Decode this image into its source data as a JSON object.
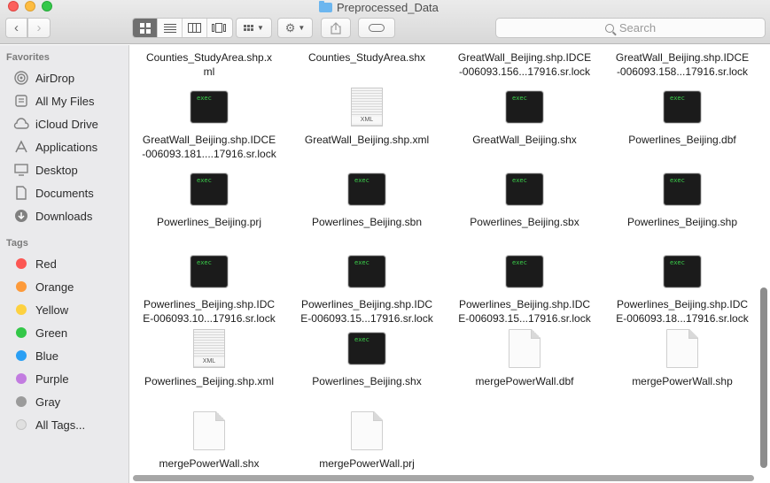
{
  "window": {
    "title": "Preprocessed_Data"
  },
  "toolbar": {
    "back_icon": "chevron-left",
    "forward_icon": "chevron-right",
    "search_placeholder": "Search"
  },
  "sidebar": {
    "favorites_header": "Favorites",
    "favorites": [
      {
        "label": "AirDrop",
        "icon": "airdrop-icon"
      },
      {
        "label": "All My Files",
        "icon": "all-files-icon"
      },
      {
        "label": "iCloud Drive",
        "icon": "cloud-icon"
      },
      {
        "label": "Applications",
        "icon": "applications-icon"
      },
      {
        "label": "Desktop",
        "icon": "desktop-icon"
      },
      {
        "label": "Documents",
        "icon": "documents-icon"
      },
      {
        "label": "Downloads",
        "icon": "downloads-icon"
      }
    ],
    "tags_header": "Tags",
    "tags": [
      {
        "label": "Red",
        "color": "#fc5753"
      },
      {
        "label": "Orange",
        "color": "#fd9a3a"
      },
      {
        "label": "Yellow",
        "color": "#fdd140"
      },
      {
        "label": "Green",
        "color": "#33c748"
      },
      {
        "label": "Blue",
        "color": "#2a9ff4"
      },
      {
        "label": "Purple",
        "color": "#c27ce0"
      },
      {
        "label": "Gray",
        "color": "#9b9b9b"
      },
      {
        "label": "All Tags...",
        "color": "#e0e0e0"
      }
    ]
  },
  "files": [
    {
      "name": "Counties_StudyArea.shp.x\nml",
      "kind": "xml"
    },
    {
      "name": "Counties_StudyArea.shx",
      "kind": "exec"
    },
    {
      "name": "GreatWall_Beijing.shp.IDCE\n-006093.156...17916.sr.lock",
      "kind": "exec"
    },
    {
      "name": "GreatWall_Beijing.shp.IDCE\n-006093.158...17916.sr.lock",
      "kind": "exec"
    },
    {
      "name": "GreatWall_Beijing.shp.IDCE\n-006093.181....17916.sr.lock",
      "kind": "exec"
    },
    {
      "name": "GreatWall_Beijing.shp.xml",
      "kind": "xml"
    },
    {
      "name": "GreatWall_Beijing.shx",
      "kind": "exec"
    },
    {
      "name": "Powerlines_Beijing.dbf",
      "kind": "exec"
    },
    {
      "name": "Powerlines_Beijing.prj",
      "kind": "exec"
    },
    {
      "name": "Powerlines_Beijing.sbn",
      "kind": "exec"
    },
    {
      "name": "Powerlines_Beijing.sbx",
      "kind": "exec"
    },
    {
      "name": "Powerlines_Beijing.shp",
      "kind": "exec"
    },
    {
      "name": "Powerlines_Beijing.shp.IDC\nE-006093.10...17916.sr.lock",
      "kind": "exec"
    },
    {
      "name": "Powerlines_Beijing.shp.IDC\nE-006093.15...17916.sr.lock",
      "kind": "exec"
    },
    {
      "name": "Powerlines_Beijing.shp.IDC\nE-006093.15...17916.sr.lock",
      "kind": "exec"
    },
    {
      "name": "Powerlines_Beijing.shp.IDC\nE-006093.18...17916.sr.lock",
      "kind": "exec"
    },
    {
      "name": "Powerlines_Beijing.shp.xml",
      "kind": "xml"
    },
    {
      "name": "Powerlines_Beijing.shx",
      "kind": "exec"
    },
    {
      "name": "mergePowerWall.dbf",
      "kind": "doc"
    },
    {
      "name": "mergePowerWall.shp",
      "kind": "doc"
    },
    {
      "name": "mergePowerWall.shx",
      "kind": "doc"
    },
    {
      "name": "mergePowerWall.prj",
      "kind": "doc"
    }
  ],
  "icon_labels": {
    "exec": "exec",
    "xml": "XML"
  }
}
